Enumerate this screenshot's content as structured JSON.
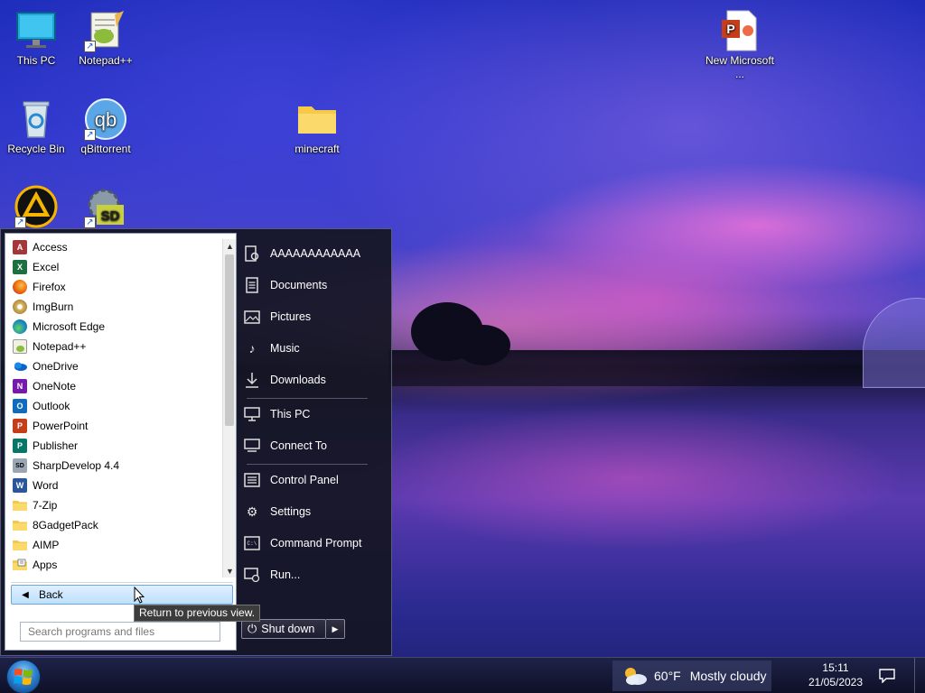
{
  "desktop": {
    "icons": [
      {
        "label": "This PC",
        "icon": "monitor-icon"
      },
      {
        "label": "Notepad++",
        "icon": "notepadpp-icon"
      },
      {
        "label": "Recycle Bin",
        "icon": "recycle-bin-icon"
      },
      {
        "label": "qBittorrent",
        "icon": "qbittorrent-icon"
      },
      {
        "label": "minecraft",
        "icon": "folder-icon"
      },
      {
        "label": "New Microsoft ...",
        "icon": "powerpoint-file-icon"
      },
      {
        "label": "",
        "icon": "aimp-icon"
      },
      {
        "label": "",
        "icon": "sharpdevelop-icon"
      }
    ]
  },
  "start_menu": {
    "programs": [
      {
        "label": "Access",
        "icon": "access-icon",
        "color": "#a4373a",
        "glyph": "A"
      },
      {
        "label": "Excel",
        "icon": "excel-icon",
        "color": "#1d6f42",
        "glyph": "X"
      },
      {
        "label": "Firefox",
        "icon": "firefox-icon",
        "color": "#e66000",
        "glyph": ""
      },
      {
        "label": "ImgBurn",
        "icon": "imgburn-icon",
        "color": "#c49a3a",
        "glyph": ""
      },
      {
        "label": "Microsoft Edge",
        "icon": "edge-icon",
        "color": "#0f7ac4",
        "glyph": ""
      },
      {
        "label": "Notepad++",
        "icon": "notepadpp-icon",
        "color": "#8dbb3c",
        "glyph": ""
      },
      {
        "label": "OneDrive",
        "icon": "onedrive-icon",
        "color": "#0a64c8",
        "glyph": ""
      },
      {
        "label": "OneNote",
        "icon": "onenote-icon",
        "color": "#7719aa",
        "glyph": "N"
      },
      {
        "label": "Outlook",
        "icon": "outlook-icon",
        "color": "#0f6cbd",
        "glyph": "O"
      },
      {
        "label": "PowerPoint",
        "icon": "powerpoint-icon",
        "color": "#c43e1c",
        "glyph": "P"
      },
      {
        "label": "Publisher",
        "icon": "publisher-icon",
        "color": "#077568",
        "glyph": "P"
      },
      {
        "label": "SharpDevelop 4.4",
        "icon": "sharpdevelop-icon",
        "color": "#3a3a3a",
        "glyph": "SD"
      },
      {
        "label": "Word",
        "icon": "word-icon",
        "color": "#2b579a",
        "glyph": "W"
      },
      {
        "label": "7-Zip",
        "icon": "folder-icon",
        "color": "#f2c94c",
        "glyph": ""
      },
      {
        "label": "8GadgetPack",
        "icon": "folder-icon",
        "color": "#f2c94c",
        "glyph": ""
      },
      {
        "label": "AIMP",
        "icon": "folder-icon",
        "color": "#f2c94c",
        "glyph": ""
      },
      {
        "label": "Apps",
        "icon": "apps-folder-icon",
        "color": "#f2c94c",
        "glyph": ""
      }
    ],
    "back_label": "Back",
    "search_placeholder": "Search programs and files",
    "right_items": [
      {
        "label": "AAAAAAAAAAAA",
        "icon": "user-icon",
        "glyph": "⚙"
      },
      {
        "label": "Documents",
        "icon": "documents-icon",
        "glyph": "☰"
      },
      {
        "label": "Pictures",
        "icon": "pictures-icon",
        "glyph": "▨"
      },
      {
        "label": "Music",
        "icon": "music-icon",
        "glyph": "♪"
      },
      {
        "label": "Downloads",
        "icon": "downloads-icon",
        "glyph": "↓"
      },
      {
        "label": "This PC",
        "icon": "computer-icon",
        "glyph": "▭"
      },
      {
        "label": "Connect To",
        "icon": "connect-icon",
        "glyph": "⇄"
      },
      {
        "label": "Control Panel",
        "icon": "control-panel-icon",
        "glyph": "☷"
      },
      {
        "label": "Settings",
        "icon": "settings-icon",
        "glyph": "⚙"
      },
      {
        "label": "Command Prompt",
        "icon": "command-prompt-icon",
        "glyph": "▣"
      },
      {
        "label": "Run...",
        "icon": "run-icon",
        "glyph": "◆"
      }
    ],
    "shutdown_label": "Shut down"
  },
  "tooltip": "Return to previous view.",
  "taskbar": {
    "weather_temp": "60°F",
    "weather_desc": "Mostly cloudy",
    "time": "15:11",
    "date": "21/05/2023"
  }
}
